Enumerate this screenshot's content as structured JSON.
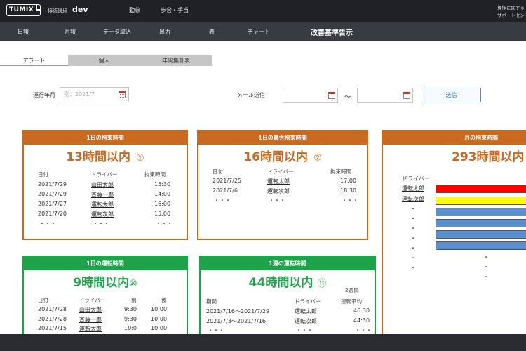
{
  "header": {
    "logo_text": "TUMIX",
    "env_label": "接続環境",
    "env_value": "dev",
    "links": [
      "勤怠",
      "歩合・手当"
    ],
    "support_lines": [
      "操作に関する",
      "サポートセン"
    ]
  },
  "nav": {
    "items": [
      "日報",
      "月報",
      "データ取込",
      "出力",
      "表",
      "チャート"
    ],
    "title": "改善基準告示"
  },
  "tabs": [
    {
      "label": "アラート",
      "active": true
    },
    {
      "label": "個人",
      "active": false
    },
    {
      "label": "年間集計表",
      "active": false
    }
  ],
  "form": {
    "month_label": "運行年月",
    "month_placeholder": "例：2021/7",
    "mail_label": "メール送信",
    "tilde": "～",
    "send_label": "送信"
  },
  "cards": {
    "daily_restraint": {
      "title": "1日の拘束時間",
      "headline": "13時間以内",
      "number": "①",
      "headers": [
        "日付",
        "ドライバー",
        "拘束時間"
      ],
      "rows": [
        [
          "2021/7/29",
          "山田太郎",
          "15:30"
        ],
        [
          "2021/7/29",
          "斉藤一郎",
          "14:00"
        ],
        [
          "2021/7/27",
          "運転太郎",
          "16:00"
        ],
        [
          "2021/7/20",
          "運転次郎",
          "15:00"
        ],
        [
          "・・・",
          "・・・",
          "・・・"
        ]
      ]
    },
    "daily_max_restraint": {
      "title": "1日の最大拘束時間",
      "headline": "16時間以内",
      "number": "②",
      "headers": [
        "日付",
        "ドライバー",
        "拘束時間"
      ],
      "rows": [
        [
          "2021/7/25",
          "運転太郎",
          "17:00"
        ],
        [
          "2021/7/6",
          "運転次郎",
          "18:30"
        ],
        [
          "・・・",
          "・・・",
          "・・・"
        ]
      ]
    },
    "monthly_restraint": {
      "title": "月の拘束時間",
      "headline": "293時間以内",
      "driver_header": "ドライバー",
      "drivers": [
        "運転太郎",
        "運転次郎"
      ],
      "dots": "・",
      "bar_colors": [
        "#ff0000",
        "#ffff00",
        "#5b8fd0",
        "#5b8fd0",
        "#5b8fd0",
        "#5b8fd0"
      ]
    },
    "daily_driving": {
      "title": "1日の運転時間",
      "headline": "9時間以内",
      "number": "⑩",
      "headers": [
        "日付",
        "ドライバー",
        "前",
        "後"
      ],
      "rows": [
        [
          "2021/7/28",
          "山田太郎",
          "9:30",
          "10:00"
        ],
        [
          "2021/7/28",
          "斉藤一郎",
          "9:30",
          "10:00"
        ],
        [
          "2021/7/15",
          "運転太郎",
          "10:0",
          "10:00"
        ]
      ]
    },
    "weekly_driving": {
      "title": "1週の運転時間",
      "headline": "44時間以内",
      "number": "⑪",
      "headers": [
        "期間",
        "ドライバー",
        "2週間",
        "運転平均"
      ],
      "rows": [
        [
          "2021/7/16～2021/7/29",
          "運転太郎",
          "46:30"
        ],
        [
          "2021/7/3～2021/7/16",
          "運転次郎",
          "44:30"
        ],
        [
          "・・・",
          "・・・",
          "・・・"
        ]
      ]
    }
  },
  "colors": {
    "orange": "#c96a20",
    "green": "#1fa34a",
    "topbar": "#1f2126",
    "navbar": "#383c42",
    "accent_blue": "#4a8cc7"
  }
}
